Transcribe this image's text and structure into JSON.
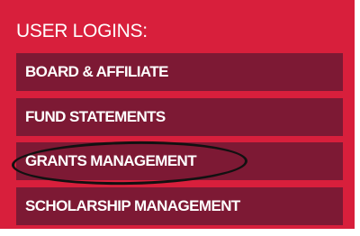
{
  "panel": {
    "heading": "USER LOGINS:",
    "items": [
      {
        "label": "BOARD & AFFILIATE"
      },
      {
        "label": "FUND STATEMENTS"
      },
      {
        "label": "GRANTS MANAGEMENT"
      },
      {
        "label": "SCHOLARSHIP MANAGEMENT"
      }
    ]
  },
  "colors": {
    "panel_background": "#d81f3c",
    "item_background": "#7d1934",
    "text": "#ffffff",
    "annotation": "#111111"
  }
}
